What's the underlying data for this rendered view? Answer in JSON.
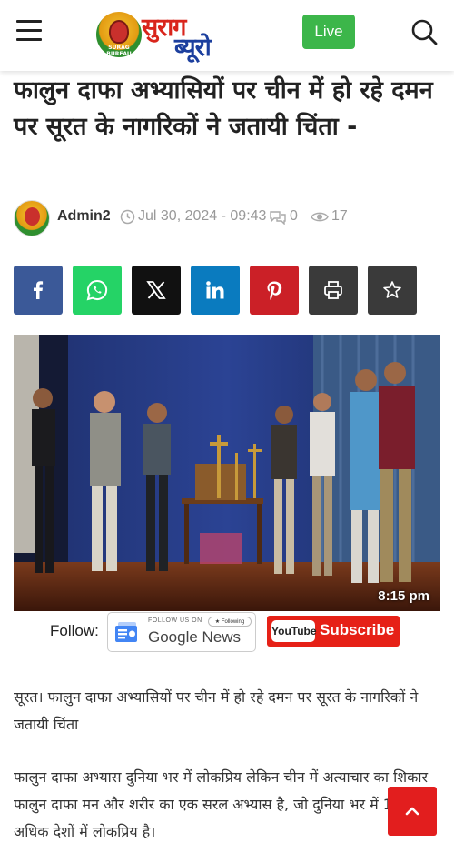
{
  "header": {
    "logo_top": "सुराग",
    "logo_bottom": "ब्यूरो",
    "logo_tag": "SURAG BUREAU",
    "live_label": "Live"
  },
  "article": {
    "title": "फालुन दाफा अभ्यासियों पर चीन में हो रहे दमन पर सूरत के नागरिकों ने जतायी चिंता -",
    "author": "Admin2",
    "date": "Jul 30, 2024 - 09:43",
    "comments": "0",
    "views": "17",
    "photo_timestamp": "8:15 pm",
    "paragraph1": "सूरत। फालुन दाफा अभ्यासियों पर चीन में हो रहे दमन पर सूरत के नागरिकों ने जतायी चिंता",
    "paragraph2": "फालुन दाफा अभ्यास दुनिया भर में लोकप्रिय लेकिन चीन में अत्याचार का शिकार फालुन दाफा मन और शरीर का एक सरल अभ्यास है, जो दुनिया भर में 100 से अधिक देशों में लोकप्रिय है।"
  },
  "share": {
    "buttons": [
      {
        "name": "facebook",
        "color": "#3b5998"
      },
      {
        "name": "whatsapp",
        "color": "#25d366"
      },
      {
        "name": "x",
        "color": "#111111"
      },
      {
        "name": "linkedin",
        "color": "#0a7bbf"
      },
      {
        "name": "pinterest",
        "color": "#cb2027"
      },
      {
        "name": "print",
        "color": "#3a3a3a"
      },
      {
        "name": "bookmark",
        "color": "#3a3a3a"
      }
    ]
  },
  "follow": {
    "label": "Follow:",
    "gnews_follow_text": "FOLLOW US ON",
    "gnews_following_text": "★ Following",
    "gnews_name": "Google News",
    "youtube_logo": "YouTube",
    "youtube_subscribe": "Subscribe"
  },
  "colors": {
    "accent_red": "#e21e1e",
    "live_green": "#3cb64a"
  }
}
